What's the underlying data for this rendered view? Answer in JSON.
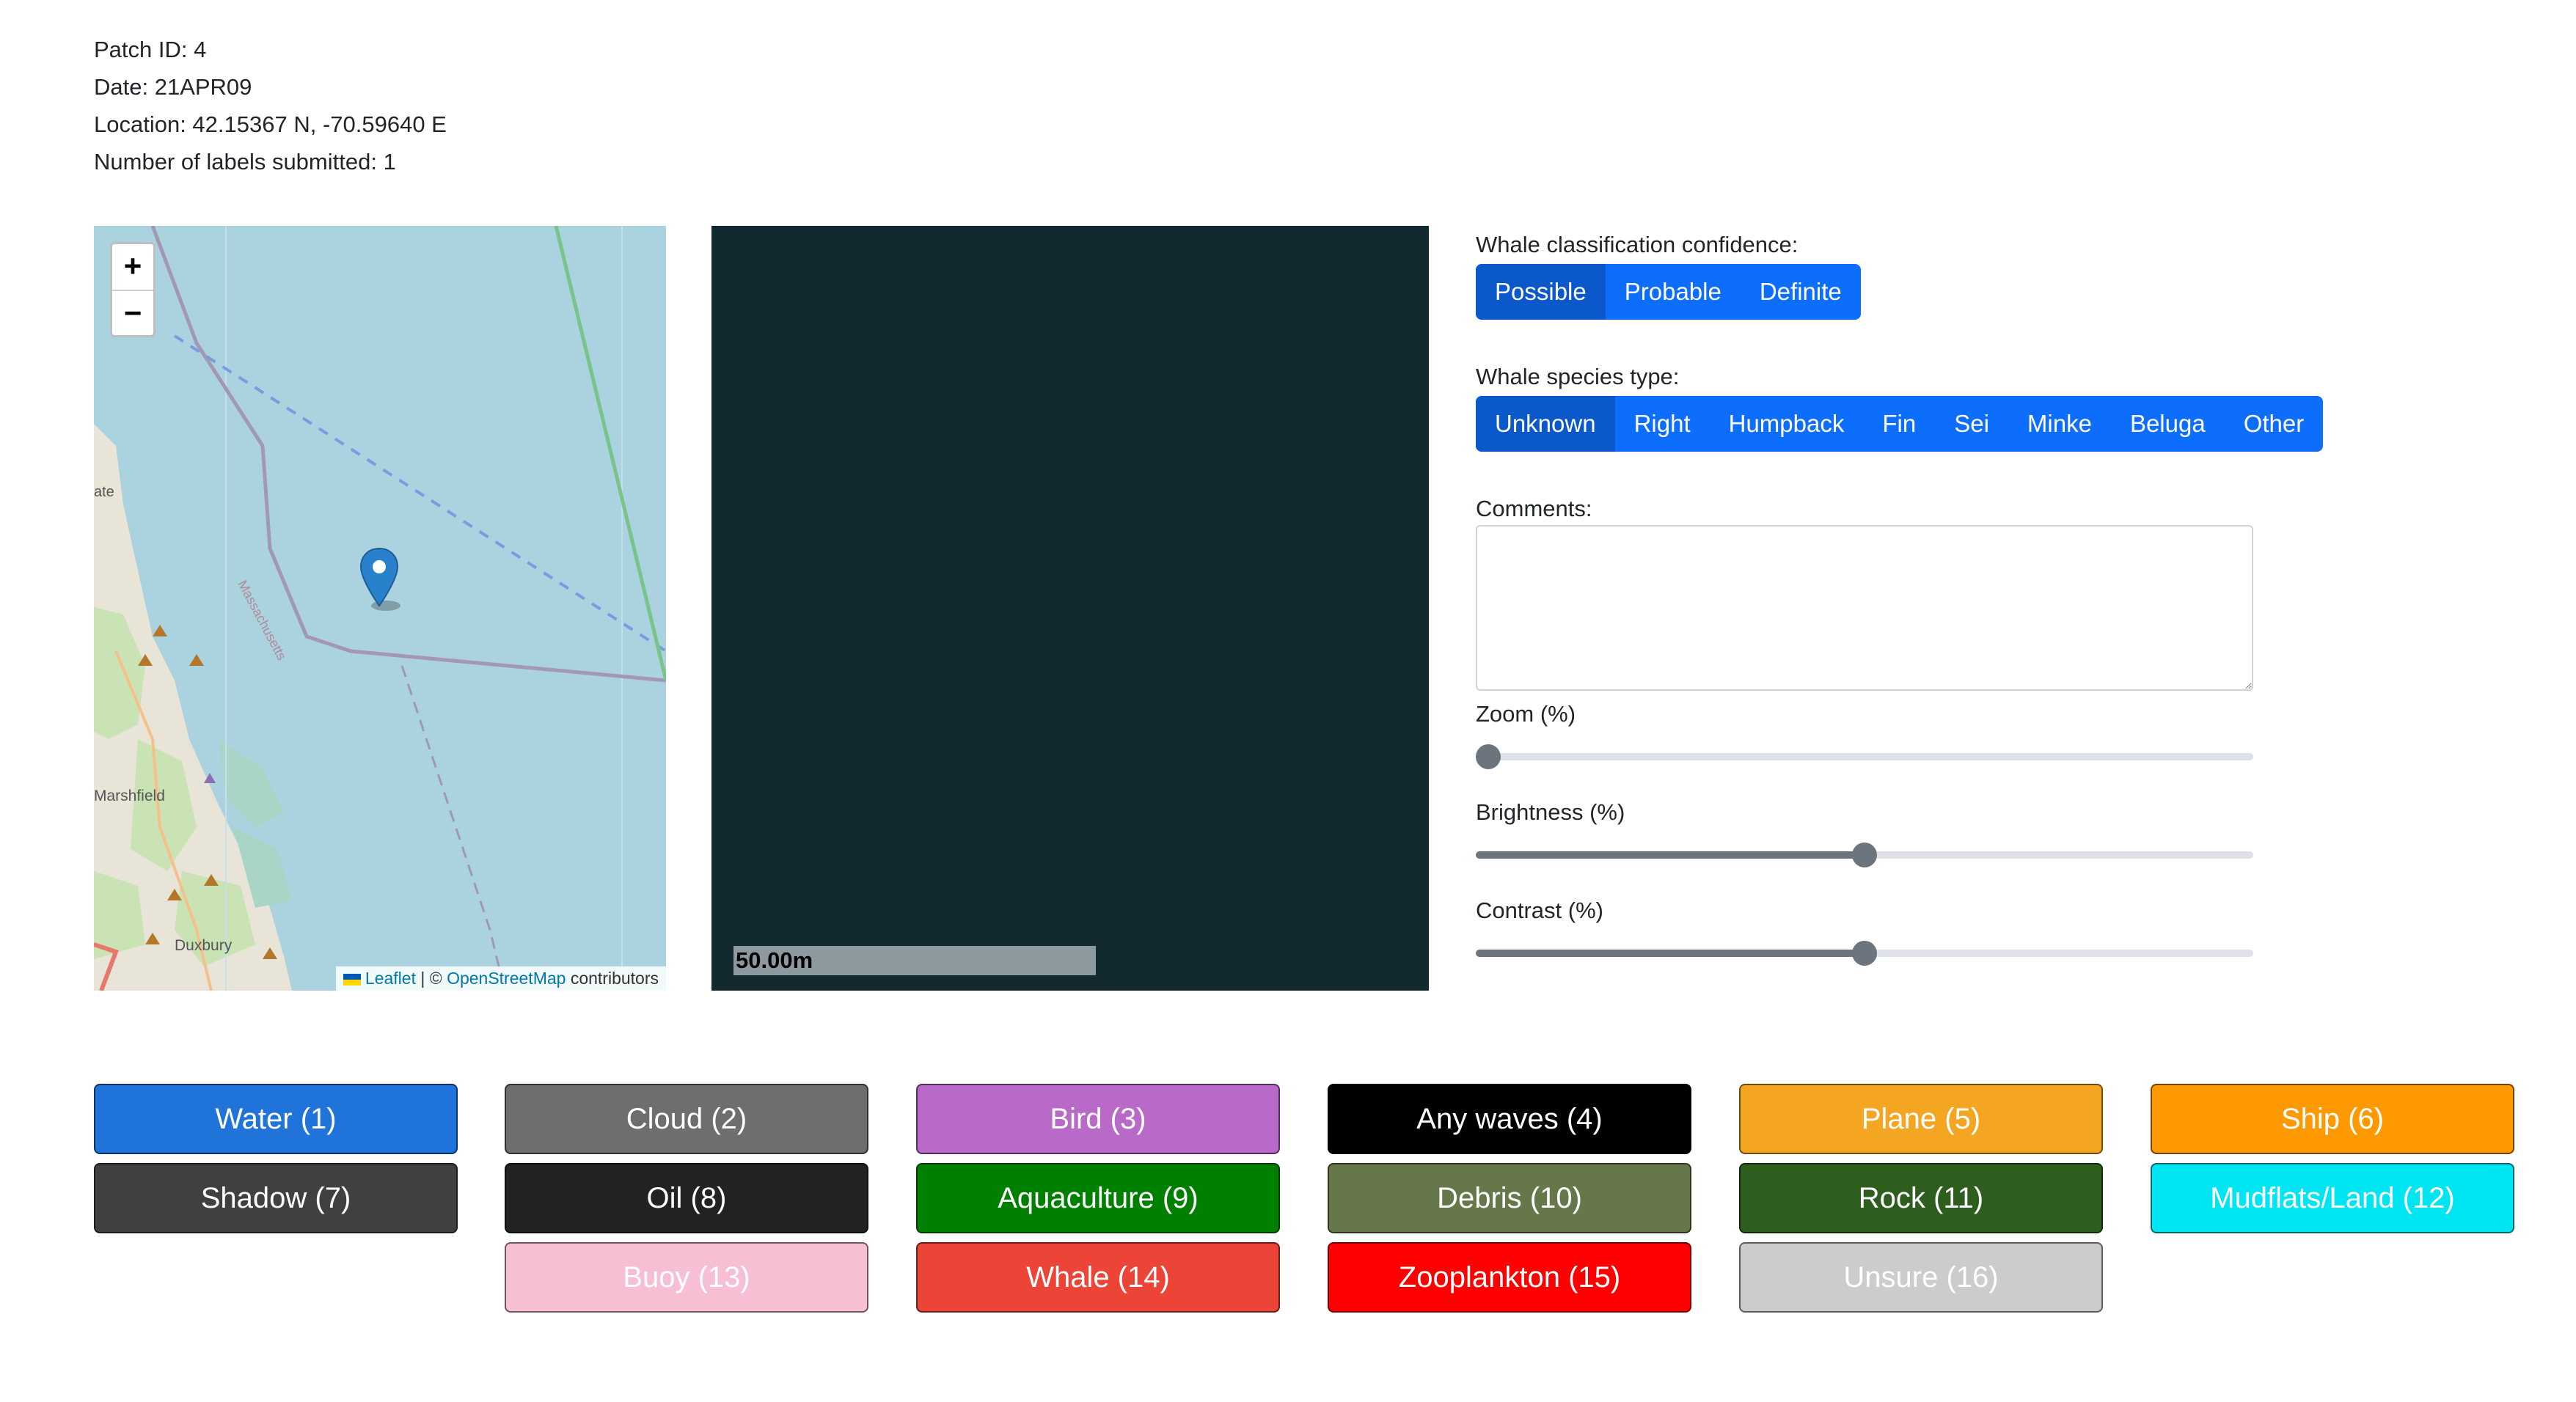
{
  "info": {
    "patch_id": "Patch ID: 4",
    "date": "Date: 21APR09",
    "location": "Location: 42.15367 N, -70.59640 E",
    "labels_submitted": "Number of labels submitted: 1"
  },
  "map": {
    "zoom_in": "+",
    "zoom_out": "−",
    "place_1": "ate",
    "place_2": "Marshfield",
    "place_3": "Duxbury",
    "boundary_label": "Massachusetts",
    "attribution": {
      "leaflet": "Leaflet",
      "sep": " | © ",
      "osm": "OpenStreetMap",
      "suffix": " contributors"
    }
  },
  "patch": {
    "scale_label": "50.00m"
  },
  "confidence": {
    "label": "Whale classification confidence:",
    "options": [
      "Possible",
      "Probable",
      "Definite"
    ],
    "selected": "Possible"
  },
  "species": {
    "label": "Whale species type:",
    "options": [
      "Unknown",
      "Right",
      "Humpback",
      "Fin",
      "Sei",
      "Minke",
      "Beluga",
      "Other"
    ],
    "selected": "Unknown"
  },
  "comments": {
    "label": "Comments:",
    "value": ""
  },
  "sliders": {
    "zoom": {
      "label": "Zoom (%)",
      "value": 0
    },
    "brightness": {
      "label": "Brightness (%)",
      "value": 50
    },
    "contrast": {
      "label": "Contrast (%)",
      "value": 50
    }
  },
  "categories": [
    {
      "label": "Water (1)",
      "color": "#1f73d9"
    },
    {
      "label": "Cloud (2)",
      "color": "#6e6e6e"
    },
    {
      "label": "Bird (3)",
      "color": "#b96ac8"
    },
    {
      "label": "Any waves (4)",
      "color": "#000000"
    },
    {
      "label": "Plane (5)",
      "color": "#f4a623"
    },
    {
      "label": "Ship (6)",
      "color": "#ff9900"
    },
    {
      "label": "Shadow (7)",
      "color": "#404040"
    },
    {
      "label": "Oil (8)",
      "color": "#222222"
    },
    {
      "label": "Aquaculture (9)",
      "color": "#008000"
    },
    {
      "label": "Debris (10)",
      "color": "#66784a"
    },
    {
      "label": "Rock (11)",
      "color": "#2e5e1e"
    },
    {
      "label": "Mudflats/Land (12)",
      "color": "#00e5f2"
    },
    {
      "label": "Buoy (13)",
      "color": "#f7bfd3"
    },
    {
      "label": "Whale (14)",
      "color": "#ec4436"
    },
    {
      "label": "Zooplankton (15)",
      "color": "#ff0000"
    },
    {
      "label": "Unsure (16)",
      "color": "#cccccc"
    }
  ]
}
